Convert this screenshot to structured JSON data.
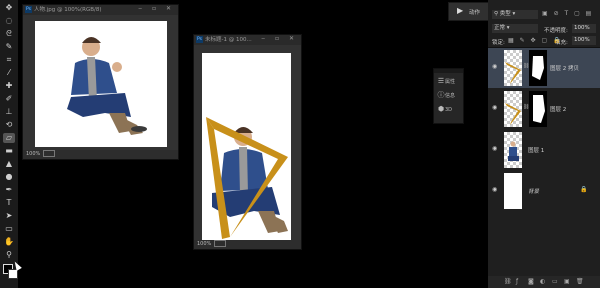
{
  "windows": {
    "doc1": {
      "title": "人物.jpg @ 100%(RGB/8)",
      "zoom": "100%"
    },
    "doc2": {
      "title": "未标题-1 @ 100...",
      "zoom": "100%"
    }
  },
  "mini_panel": {
    "items": [
      {
        "label": "属性",
        "icon": "properties-icon"
      },
      {
        "label": "信息",
        "icon": "info-icon"
      },
      {
        "label": "3D",
        "icon": "3d-icon"
      }
    ]
  },
  "actions_panel": {
    "label": "动作"
  },
  "layers": {
    "filter_label": "类型",
    "blend_mode": "正常",
    "opacity_label": "不透明度:",
    "opacity_value": "100%",
    "lock_label": "锁定:",
    "fill_label": "填充:",
    "fill_value": "100%",
    "items": [
      {
        "name": "图层 2 拷贝"
      },
      {
        "name": "图层 2"
      },
      {
        "name": "图层 1"
      },
      {
        "name": "背景"
      }
    ]
  },
  "colors": {
    "accent": "#c8901a",
    "selected_layer": "#3d4654"
  }
}
